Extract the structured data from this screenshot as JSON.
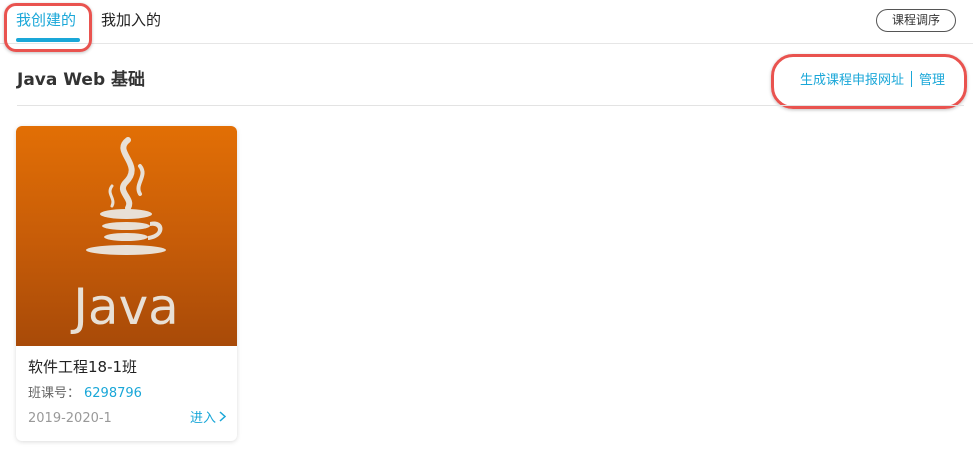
{
  "tabs": {
    "created": "我创建的",
    "joined": "我加入的"
  },
  "toolbar": {
    "order_label": "课程调序"
  },
  "course": {
    "title": "Java Web 基础",
    "generate_link_label": "生成课程申报网址",
    "manage_label": "管理"
  },
  "class_card": {
    "cover_text": "Java",
    "name": "软件工程18-1班",
    "code_label": "班课号：",
    "code_value": "6298796",
    "term": "2019-2020-1",
    "enter_label": "进入"
  },
  "colors": {
    "accent": "#1aa7d8",
    "highlight": "#e9534f",
    "cover_top": "#e26f05",
    "cover_bottom": "#a84a08"
  },
  "icons": {
    "cover_logo": "java-coffee-cup-icon",
    "enter": "chevron-right-icon"
  }
}
